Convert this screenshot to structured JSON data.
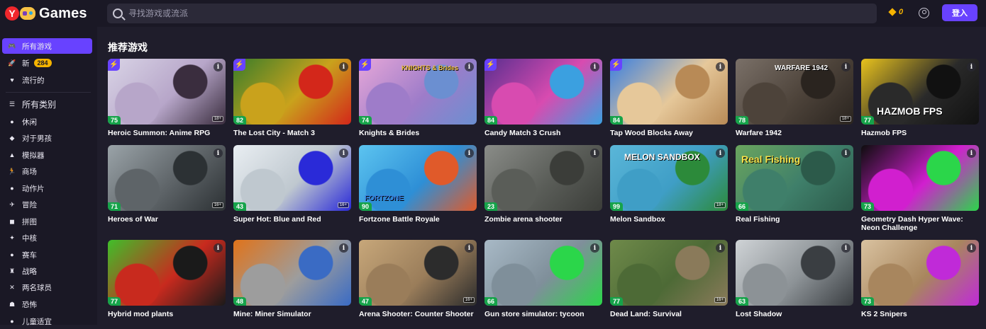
{
  "header": {
    "logo_text": "Games",
    "search_placeholder": "寻找游戏或流派",
    "coins": "0",
    "login_label": "登入"
  },
  "sidebar": {
    "items": [
      {
        "label": "所有游戏",
        "icon": "gamepad-icon",
        "active": true
      },
      {
        "label": "新",
        "icon": "rocket-icon",
        "badge": "284"
      },
      {
        "label": "流行的",
        "icon": "heart-icon"
      },
      {
        "label": "所有类别",
        "icon": "list-icon"
      },
      {
        "label": "休闲",
        "icon": "casual-icon"
      },
      {
        "label": "对于男孩",
        "icon": "boys-icon"
      },
      {
        "label": "模拟器",
        "icon": "simulator-icon"
      },
      {
        "label": "商场",
        "icon": "runner-icon"
      },
      {
        "label": "动作片",
        "icon": "bomb-icon"
      },
      {
        "label": "冒险",
        "icon": "adventure-icon"
      },
      {
        "label": "拼图",
        "icon": "puzzle-icon"
      },
      {
        "label": "中核",
        "icon": "midcore-icon"
      },
      {
        "label": "赛车",
        "icon": "racing-icon"
      },
      {
        "label": "战略",
        "icon": "strategy-icon"
      },
      {
        "label": "两名球员",
        "icon": "two-players-icon"
      },
      {
        "label": "恐怖",
        "icon": "ghost-icon"
      },
      {
        "label": "儿童适宜",
        "icon": "kids-icon"
      }
    ]
  },
  "main": {
    "section_title": "推荐游戏",
    "games": [
      {
        "title": "Heroic Summon: Anime RPG",
        "rating": "75",
        "bolt": true,
        "age": "18+",
        "colors": [
          "#d9d4e6",
          "#b7a6c9",
          "#3a2d3e"
        ]
      },
      {
        "title": "The Lost City - Match 3",
        "rating": "82",
        "bolt": true,
        "age": "",
        "colors": [
          "#3a7d2a",
          "#c9a21c",
          "#d3271a"
        ]
      },
      {
        "title": "Knights & Brides",
        "rating": "74",
        "bolt": true,
        "age": "",
        "colors": [
          "#e6a7d8",
          "#9e7cc9",
          "#6b8fd1"
        ],
        "art_text": "KNIGHTS & Brides"
      },
      {
        "title": "Candy Match 3 Crush",
        "rating": "84",
        "bolt": true,
        "age": "",
        "colors": [
          "#5a2f8f",
          "#d84bb0",
          "#3ba0e0"
        ]
      },
      {
        "title": "Tap Wood Blocks Away",
        "rating": "84",
        "bolt": true,
        "age": "",
        "colors": [
          "#3a7fe0",
          "#e6c89a",
          "#b88a56"
        ]
      },
      {
        "title": "Warfare 1942",
        "rating": "78",
        "bolt": false,
        "age": "18+",
        "colors": [
          "#7a7068",
          "#4d433a",
          "#2a241f"
        ],
        "art_text": "WARFARE 1942"
      },
      {
        "title": "Hazmob FPS",
        "rating": "77",
        "bolt": false,
        "age": "",
        "colors": [
          "#e8c21d",
          "#2a2a2a",
          "#111111"
        ],
        "art_text": "HAZMOB FPS"
      },
      {
        "title": "Heroes of War",
        "rating": "71",
        "bolt": false,
        "age": "16+",
        "colors": [
          "#9aa3a8",
          "#5e6468",
          "#2c3134"
        ]
      },
      {
        "title": "Super Hot: Blue and Red",
        "rating": "43",
        "bolt": false,
        "age": "16+",
        "colors": [
          "#e9eef2",
          "#bfc8cf",
          "#2a2ad8"
        ]
      },
      {
        "title": "Fortzone Battle Royale",
        "rating": "90",
        "bolt": false,
        "age": "",
        "colors": [
          "#5cc4f0",
          "#2e8fd6",
          "#e05a2a"
        ],
        "art_text": "FORTZONE"
      },
      {
        "title": "Zombie arena shooter",
        "rating": "23",
        "bolt": false,
        "age": "",
        "colors": [
          "#8a8c88",
          "#5a5d58",
          "#3b3d39"
        ]
      },
      {
        "title": "Melon Sandbox",
        "rating": "99",
        "bolt": false,
        "age": "18+",
        "colors": [
          "#5ab6d8",
          "#3f9ec6",
          "#2c8a3a"
        ],
        "art_text": "MELON SANDBOX"
      },
      {
        "title": "Real Fishing",
        "rating": "66",
        "bolt": false,
        "age": "",
        "colors": [
          "#6aa55e",
          "#3f7f6a",
          "#2c5a4a"
        ],
        "art_text": "Real Fishing"
      },
      {
        "title": "Geometry Dash Hyper Wave: Neon Challenge",
        "rating": "73",
        "bolt": false,
        "age": "",
        "colors": [
          "#0d0d0d",
          "#d11fcf",
          "#2bd64a"
        ]
      },
      {
        "title": "Hybrid mod plants",
        "rating": "77",
        "bolt": false,
        "age": "",
        "colors": [
          "#3fbf2a",
          "#c82a1e",
          "#1a1a1a"
        ]
      },
      {
        "title": "Mine: Miner Simulator",
        "rating": "48",
        "bolt": false,
        "age": "",
        "colors": [
          "#e0731a",
          "#9d9d9d",
          "#3a6bc4"
        ]
      },
      {
        "title": "Arena Shooter: Counter Shooter",
        "rating": "47",
        "bolt": false,
        "age": "16+",
        "colors": [
          "#c7a77a",
          "#9a7d5a",
          "#2c2c2c"
        ]
      },
      {
        "title": "Gun store simulator: tycoon",
        "rating": "66",
        "bolt": false,
        "age": "",
        "colors": [
          "#a8b9c6",
          "#7f8f9a",
          "#2bd64a"
        ]
      },
      {
        "title": "Dead Land: Survival",
        "rating": "77",
        "bolt": false,
        "age": "16+",
        "colors": [
          "#6f8a4a",
          "#4d6a36",
          "#8a7a5a"
        ]
      },
      {
        "title": "Lost Shadow",
        "rating": "63",
        "bolt": false,
        "age": "",
        "colors": [
          "#cfd3d6",
          "#8c9296",
          "#3a3e42"
        ]
      },
      {
        "title": "KS 2 Snipers",
        "rating": "73",
        "bolt": false,
        "age": "",
        "colors": [
          "#d9c2a0",
          "#a8865e",
          "#c02ad8"
        ]
      }
    ]
  }
}
